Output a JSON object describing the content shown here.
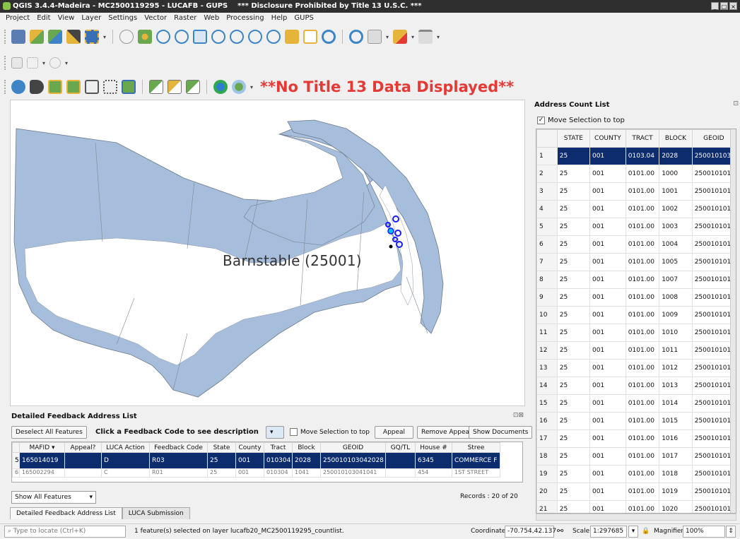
{
  "window": {
    "title": "QGIS 3.4.4-Madeira - MC2500119295 - LUCAFB - GUPS",
    "disclosure": "*** Disclosure Prohibited by Title 13 U.S.C. ***"
  },
  "menu": [
    "Project",
    "Edit",
    "View",
    "Layer",
    "Settings",
    "Vector",
    "Raster",
    "Web",
    "Processing",
    "Help",
    "GUPS"
  ],
  "toolbar": {
    "notice": "**No Title 13 Data Displayed**"
  },
  "map": {
    "label": "Barnstable (25001)"
  },
  "address_count": {
    "title": "Address Count List",
    "move_selection": "Move Selection to top",
    "move_selection_checked": true,
    "columns": [
      "STATE",
      "COUNTY",
      "TRACT",
      "BLOCK",
      "GEOID"
    ],
    "rows": [
      [
        "1",
        "25",
        "001",
        "0103.04",
        "2028",
        "2500101030"
      ],
      [
        "2",
        "25",
        "001",
        "0101.00",
        "1000",
        "2500101010"
      ],
      [
        "3",
        "25",
        "001",
        "0101.00",
        "1001",
        "2500101010"
      ],
      [
        "4",
        "25",
        "001",
        "0101.00",
        "1002",
        "2500101010"
      ],
      [
        "5",
        "25",
        "001",
        "0101.00",
        "1003",
        "2500101010"
      ],
      [
        "6",
        "25",
        "001",
        "0101.00",
        "1004",
        "2500101010"
      ],
      [
        "7",
        "25",
        "001",
        "0101.00",
        "1005",
        "2500101010"
      ],
      [
        "8",
        "25",
        "001",
        "0101.00",
        "1007",
        "2500101010"
      ],
      [
        "9",
        "25",
        "001",
        "0101.00",
        "1008",
        "2500101010"
      ],
      [
        "10",
        "25",
        "001",
        "0101.00",
        "1009",
        "2500101010"
      ],
      [
        "11",
        "25",
        "001",
        "0101.00",
        "1010",
        "2500101010"
      ],
      [
        "12",
        "25",
        "001",
        "0101.00",
        "1011",
        "2500101010"
      ],
      [
        "13",
        "25",
        "001",
        "0101.00",
        "1012",
        "2500101010"
      ],
      [
        "14",
        "25",
        "001",
        "0101.00",
        "1013",
        "2500101010"
      ],
      [
        "15",
        "25",
        "001",
        "0101.00",
        "1014",
        "2500101010"
      ],
      [
        "16",
        "25",
        "001",
        "0101.00",
        "1015",
        "2500101010"
      ],
      [
        "17",
        "25",
        "001",
        "0101.00",
        "1016",
        "2500101010"
      ],
      [
        "18",
        "25",
        "001",
        "0101.00",
        "1017",
        "2500101010"
      ],
      [
        "19",
        "25",
        "001",
        "0101.00",
        "1018",
        "2500101010"
      ],
      [
        "20",
        "25",
        "001",
        "0101.00",
        "1019",
        "2500101010"
      ],
      [
        "21",
        "25",
        "001",
        "0101.00",
        "1020",
        "2500101010"
      ]
    ]
  },
  "feedback": {
    "title": "Detailed Feedback Address List",
    "deselect_label": "Deselect All Features",
    "hint": "Click a Feedback Code to see description",
    "move_selection": "Move Selection to top",
    "appeal_label": "Appeal",
    "remove_appeal_label": "Remove Appeal",
    "show_documents_label": "Show Documents",
    "columns": [
      "MAFID",
      "Appeal?",
      "LUCA Action",
      "Feedback Code",
      "State",
      "County",
      "Tract",
      "Block",
      "GEOID",
      "GQ/TL",
      "House #",
      "Stree"
    ],
    "rows": [
      [
        "5",
        "165014019",
        "",
        "D",
        "R03",
        "25",
        "001",
        "010304",
        "2028",
        "250010103042028",
        "",
        "6345",
        "COMMERCE F"
      ],
      [
        "6",
        "165002294",
        "",
        "C",
        "R01",
        "25",
        "001",
        "010304",
        "1041",
        "250010103041041",
        "",
        "454",
        "1ST STREET"
      ]
    ],
    "filter": "Show All Features",
    "records": "Records : 20 of 20",
    "tabs": [
      "Detailed Feedback Address List",
      "LUCA Submission"
    ]
  },
  "status": {
    "locate_placeholder": "Type to locate (Ctrl+K)",
    "message": "1 feature(s) selected on layer lucafb20_MC2500119295_countlist.",
    "coordinate_label": "Coordinate",
    "coordinate": "-70.754,42.137",
    "scale_label": "Scale",
    "scale": "1:297685",
    "magnifier_label": "Magnifier",
    "magnifier": "100%"
  },
  "colors": {
    "land": "#a6bddb",
    "selection": "#0c2c6e",
    "notice": "#e53935",
    "point": "#1a1aff"
  }
}
